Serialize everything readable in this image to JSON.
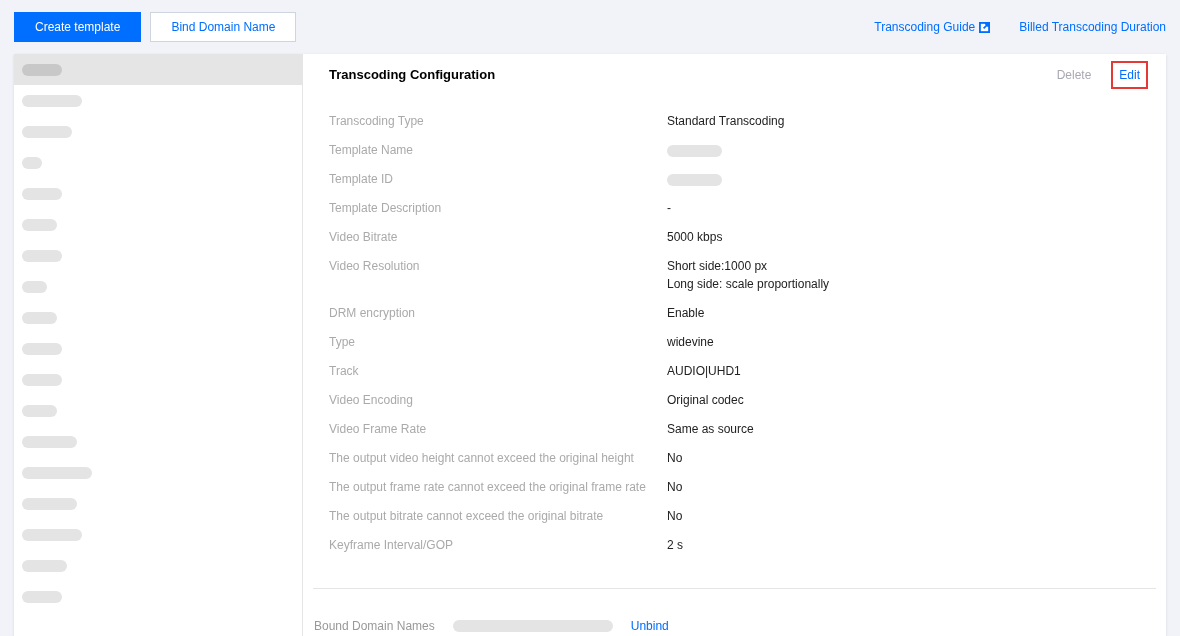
{
  "toolbar": {
    "buttons": [
      {
        "label": "Create template",
        "kind": "primary"
      },
      {
        "label": "Bind Domain Name",
        "kind": "secondary"
      }
    ],
    "links": [
      {
        "label": "Transcoding Guide",
        "external": true
      },
      {
        "label": "Billed Transcoding Duration",
        "external": false
      }
    ]
  },
  "sidebar": {
    "items": [
      {
        "selected": true
      },
      {
        "selected": false
      },
      {
        "selected": false
      },
      {
        "selected": false
      },
      {
        "selected": false
      },
      {
        "selected": false
      },
      {
        "selected": false
      },
      {
        "selected": false
      },
      {
        "selected": false
      },
      {
        "selected": false
      },
      {
        "selected": false
      },
      {
        "selected": false
      },
      {
        "selected": false
      },
      {
        "selected": false
      },
      {
        "selected": false
      },
      {
        "selected": false
      },
      {
        "selected": false
      },
      {
        "selected": false
      }
    ]
  },
  "detail": {
    "title": "Transcoding Configuration",
    "actions": [
      {
        "label": "Delete",
        "disabled": true,
        "highlighted": false
      },
      {
        "label": "Edit",
        "disabled": false,
        "highlighted": true
      }
    ],
    "fields": [
      {
        "label": "Transcoding Type",
        "values": [
          "Standard Transcoding"
        ]
      },
      {
        "label": "Template Name",
        "redacted": true
      },
      {
        "label": "Template ID",
        "redacted": true
      },
      {
        "label": "Template Description",
        "values": [
          "-"
        ]
      },
      {
        "label": "Video Bitrate",
        "values": [
          "5000 kbps"
        ]
      },
      {
        "label": "Video Resolution",
        "values": [
          "Short side:1000 px",
          "Long side: scale proportionally"
        ]
      },
      {
        "label": "DRM encryption",
        "values": [
          "Enable"
        ]
      },
      {
        "label": "Type",
        "values": [
          "widevine"
        ]
      },
      {
        "label": "Track",
        "values": [
          "AUDIO|UHD1"
        ]
      },
      {
        "label": "Video Encoding",
        "values": [
          "Original codec"
        ]
      },
      {
        "label": "Video Frame Rate",
        "values": [
          "Same as source"
        ]
      },
      {
        "label": "The output video height cannot exceed the original height",
        "values": [
          "No"
        ]
      },
      {
        "label": "The output frame rate cannot exceed the original frame rate",
        "values": [
          "No"
        ]
      },
      {
        "label": "The output bitrate cannot exceed the original bitrate",
        "values": [
          "No"
        ]
      },
      {
        "label": "Keyframe Interval/GOP",
        "values": [
          "2 s"
        ]
      }
    ],
    "bound_domains": {
      "label": "Bound Domain Names",
      "redacted": true,
      "action": "Unbind"
    }
  }
}
